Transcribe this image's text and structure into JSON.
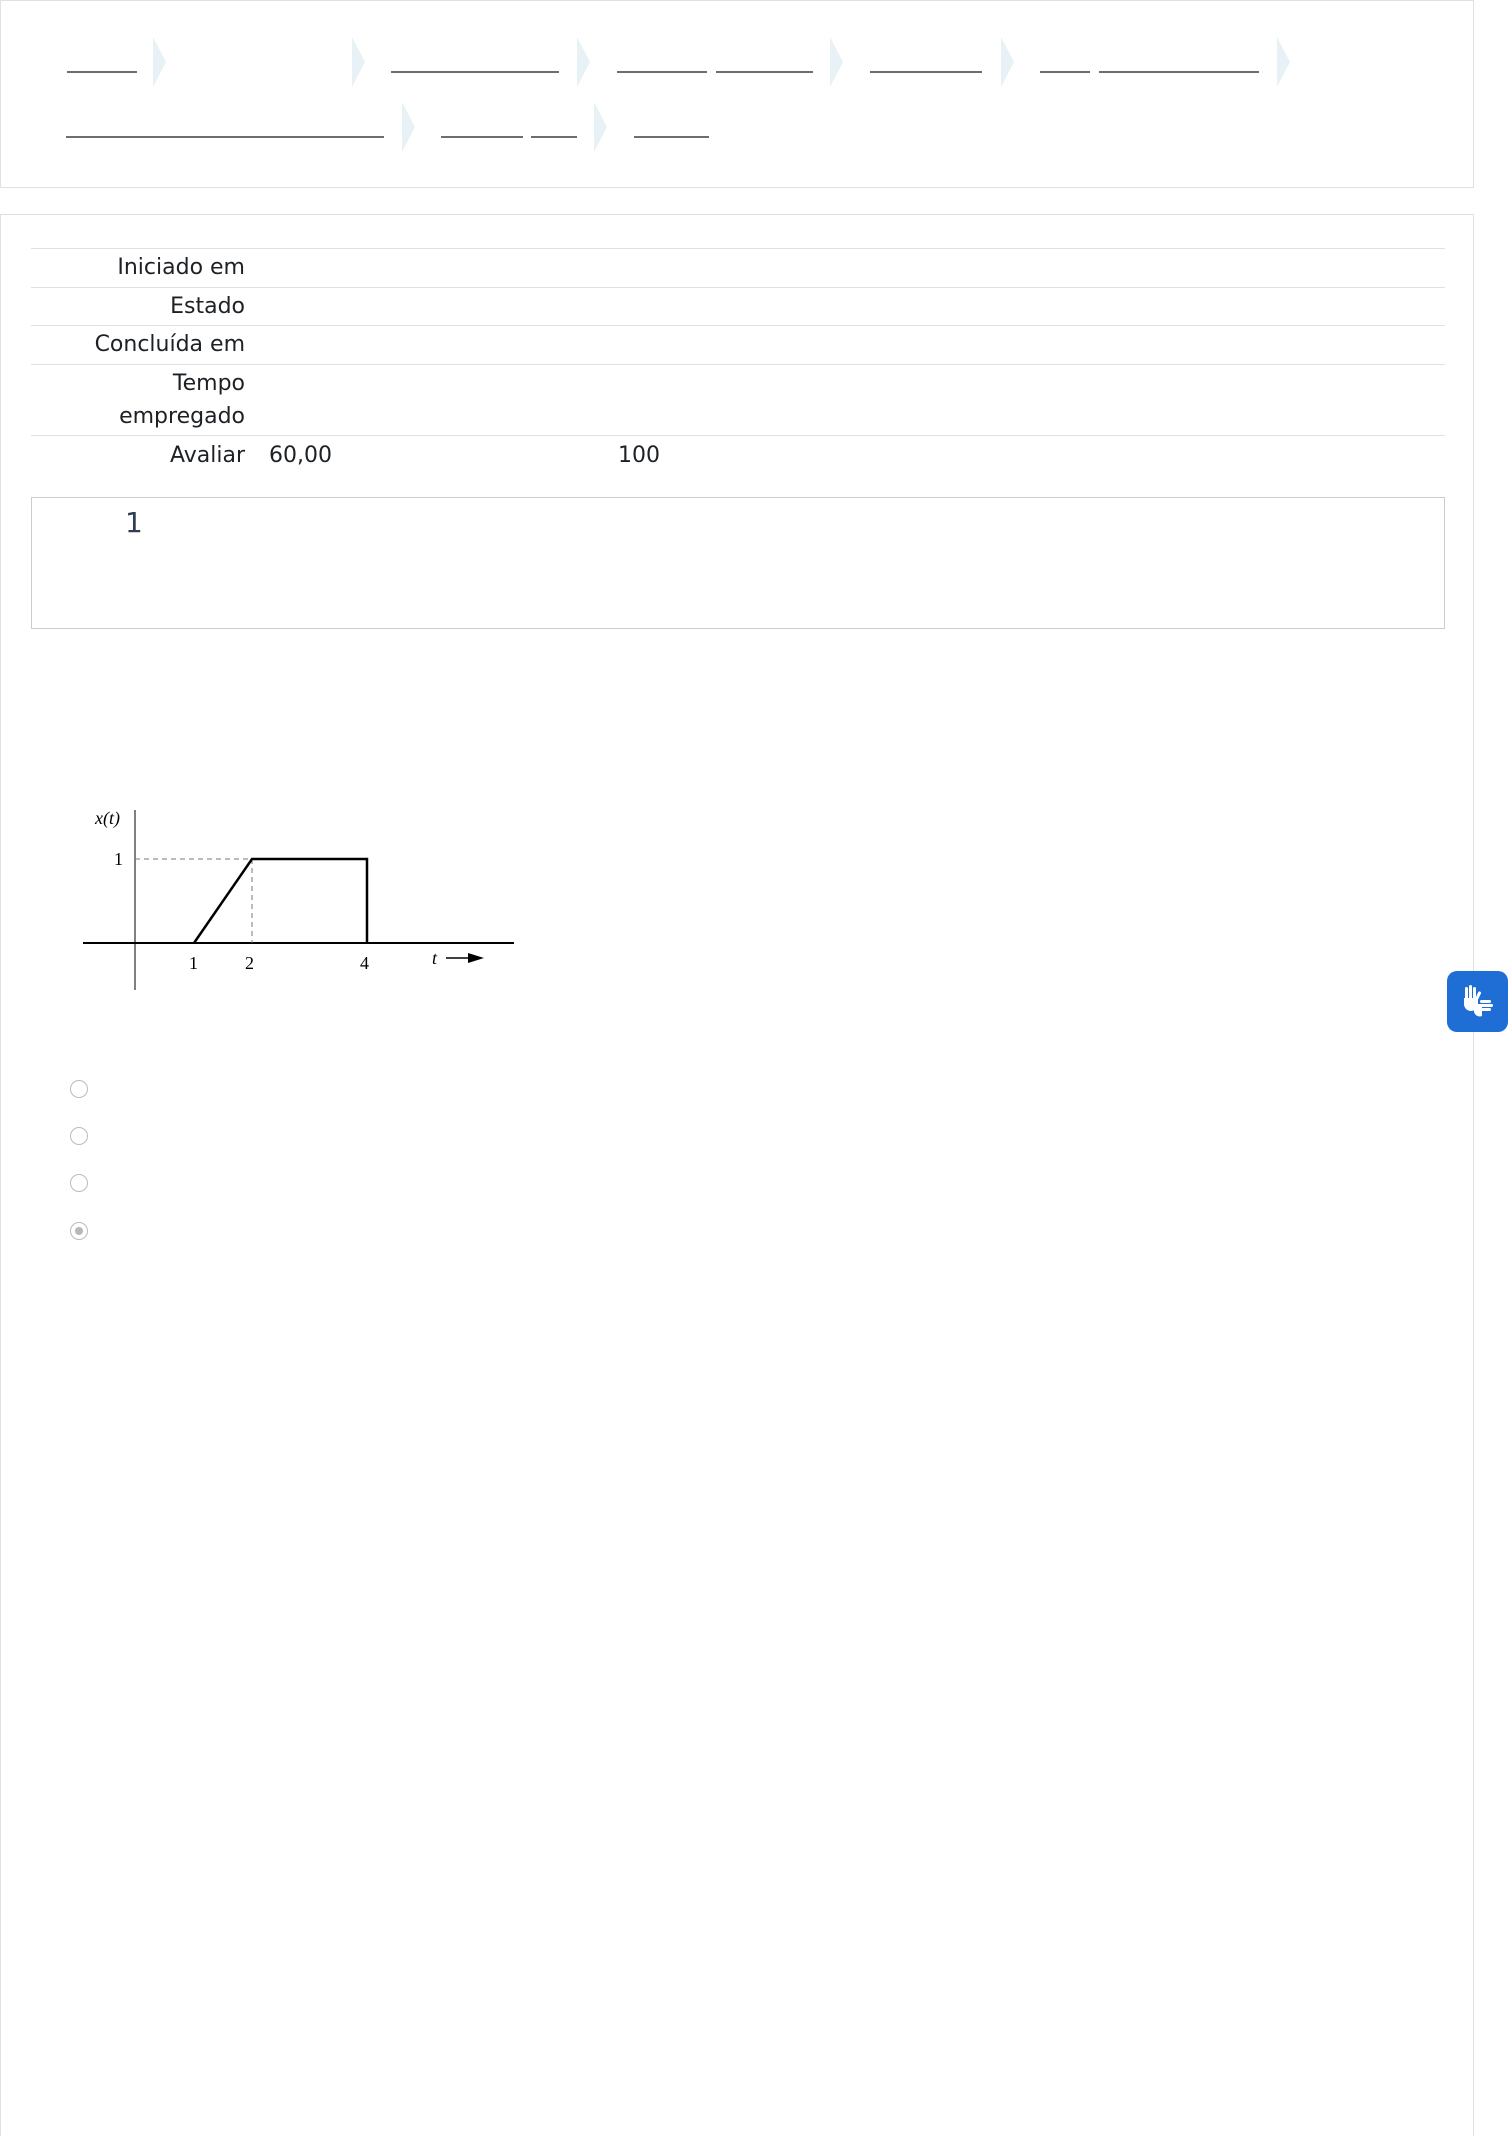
{
  "summary": {
    "rows": [
      {
        "label": "Iniciado em",
        "value": ""
      },
      {
        "label": "Estado",
        "value": ""
      },
      {
        "label": "Concluída em",
        "value": ""
      },
      {
        "label_line1": "Tempo",
        "label_line2": "empregado",
        "value": ""
      },
      {
        "label": "Avaliar",
        "value": "60,00",
        "value_max": "100"
      }
    ]
  },
  "question": {
    "number": "1"
  },
  "figure": {
    "y_label": "x(t)",
    "y_tick": "1",
    "x_ticks": [
      "1",
      "2",
      "4"
    ],
    "x_label": "t"
  },
  "options": {
    "count": 4,
    "selected_index": 3
  },
  "accessibility_widget": {
    "icon": "sign-language-hands-icon",
    "color": "#1f6ed6"
  }
}
